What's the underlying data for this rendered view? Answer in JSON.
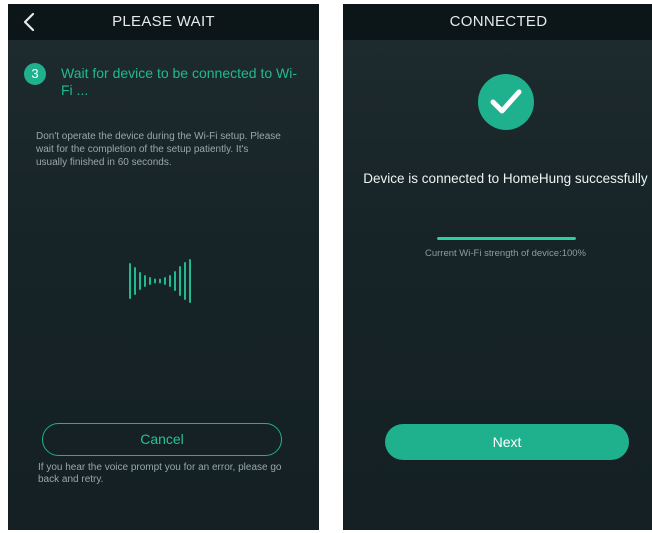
{
  "left_screen": {
    "header": {
      "title": "PLEASE WAIT",
      "back_icon": "chevron-left-icon"
    },
    "step": {
      "number": "3",
      "text": "Wait for device to be connected to Wi-Fi ..."
    },
    "instruction": "Don't operate the device during the Wi-Fi setup. Please wait for the completion of the setup patiently. It's usually finished in 60 seconds.",
    "animation_icon": "sound-wave-icon",
    "cancel_label": "Cancel",
    "error_hint": "If you hear the voice prompt you for an error, please go back and retry."
  },
  "right_screen": {
    "header": {
      "title": "CONNECTED"
    },
    "success_icon": "checkmark-icon",
    "success_message": "Device is connected to HomeHung successfully",
    "wifi_strength": {
      "label": "Current Wi-Fi strength of device:100%",
      "percent": 100
    },
    "next_label": "Next"
  },
  "colors": {
    "accent": "#1fb08e",
    "background": "#172427",
    "header": "#0c1517"
  }
}
